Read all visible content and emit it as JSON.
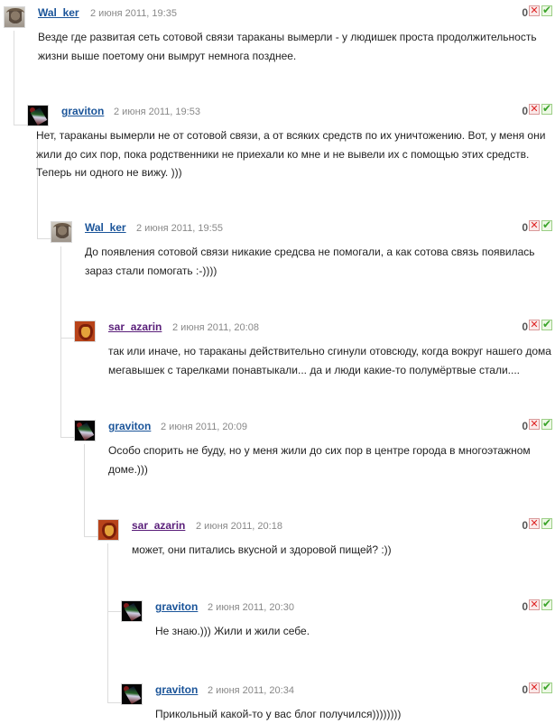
{
  "comments": [
    {
      "author": "Wal_ker",
      "date": "2 июня 2011, 19:35",
      "score": "0",
      "text": "Везде где развитая сеть сотовой связи тараканы вымерли - у людишек проста продолжительность жизни выше поетому они вымрут немнога позднее."
    },
    {
      "author": "graviton",
      "date": "2 июня 2011, 19:53",
      "score": "0",
      "text": "Нет, тараканы вымерли не от сотовой связи, а от всяких средств по их уничтожению. Вот, у меня они жили до сих пор, пока родственники не приехали ко мне и не вывели их с помощью этих средств. Теперь ни одного не вижу. )))"
    },
    {
      "author": "Wal_ker",
      "date": "2 июня 2011, 19:55",
      "score": "0",
      "text": "До появления сотовой связи никакие средсва не помогали, а как сотова связь появилась зараз стали помогать :-))))"
    },
    {
      "author": "sar_azarin",
      "date": "2 июня 2011, 20:08",
      "score": "0",
      "text": "так или иначе, но тараканы действительно сгинули отовсюду, когда вокруг нашего дома мегавышек с тарелками понавтыкали... да и люди какие-то полумёртвые стали...."
    },
    {
      "author": "graviton",
      "date": "2 июня 2011, 20:09",
      "score": "0",
      "text": "Особо спорить не буду, но у меня жили до сих пор в центре города в многоэтажном доме.)))"
    },
    {
      "author": "sar_azarin",
      "date": "2 июня 2011, 20:18",
      "score": "0",
      "text": "может, они питались вкусной и здоровой пищей? :))"
    },
    {
      "author": "graviton",
      "date": "2 июня 2011, 20:30",
      "score": "0",
      "text": "Не знаю.))) Жили и жили себе."
    },
    {
      "author": "graviton",
      "date": "2 июня 2011, 20:34",
      "score": "0",
      "text": "Прикольный какой-то у вас блог получился))))))))"
    }
  ]
}
